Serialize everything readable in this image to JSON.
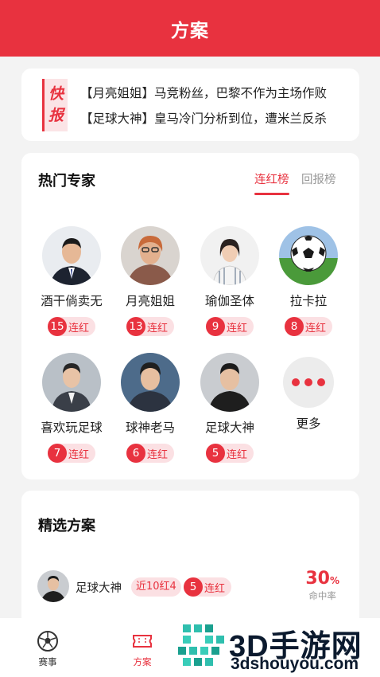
{
  "header": {
    "title": "方案"
  },
  "news": {
    "logo_chars": [
      "快",
      "报"
    ],
    "lines": [
      "【月亮姐姐】马竞粉丝，巴黎不作为主场作败",
      "【足球大神】皇马冷门分析到位，遭米兰反杀"
    ]
  },
  "experts": {
    "title": "热门专家",
    "tabs": [
      {
        "label": "连红榜",
        "active": true
      },
      {
        "label": "回报榜",
        "active": false
      }
    ],
    "items": [
      {
        "name": "酒干倘卖无",
        "streak": "15",
        "streak_label": "连红"
      },
      {
        "name": "月亮姐姐",
        "streak": "13",
        "streak_label": "连红"
      },
      {
        "name": "瑜伽圣体",
        "streak": "9",
        "streak_label": "连红"
      },
      {
        "name": "拉卡拉",
        "streak": "8",
        "streak_label": "连红"
      },
      {
        "name": "喜欢玩足球",
        "streak": "7",
        "streak_label": "连红"
      },
      {
        "name": "球神老马",
        "streak": "6",
        "streak_label": "连红"
      },
      {
        "name": "足球大神",
        "streak": "5",
        "streak_label": "连红"
      }
    ],
    "more_label": "更多"
  },
  "picks": {
    "title": "精选方案",
    "rows": [
      {
        "name": "足球大神",
        "recent": "近10红4",
        "streak": "5",
        "streak_label": "连红",
        "rate_value": "30",
        "rate_unit": "%",
        "rate_label": "命中率"
      }
    ]
  },
  "bottom_nav": {
    "items": [
      {
        "label": "赛事",
        "icon": "soccer-ball-icon",
        "active": false
      },
      {
        "label": "方案",
        "icon": "ticket-icon",
        "active": true
      }
    ]
  },
  "watermark": {
    "text": "3D手游网",
    "url": "3dshouyou.com"
  },
  "colors": {
    "brand": "#e8323f",
    "badge_bg": "#fbe0e3",
    "page_bg": "#f3f3f3"
  }
}
